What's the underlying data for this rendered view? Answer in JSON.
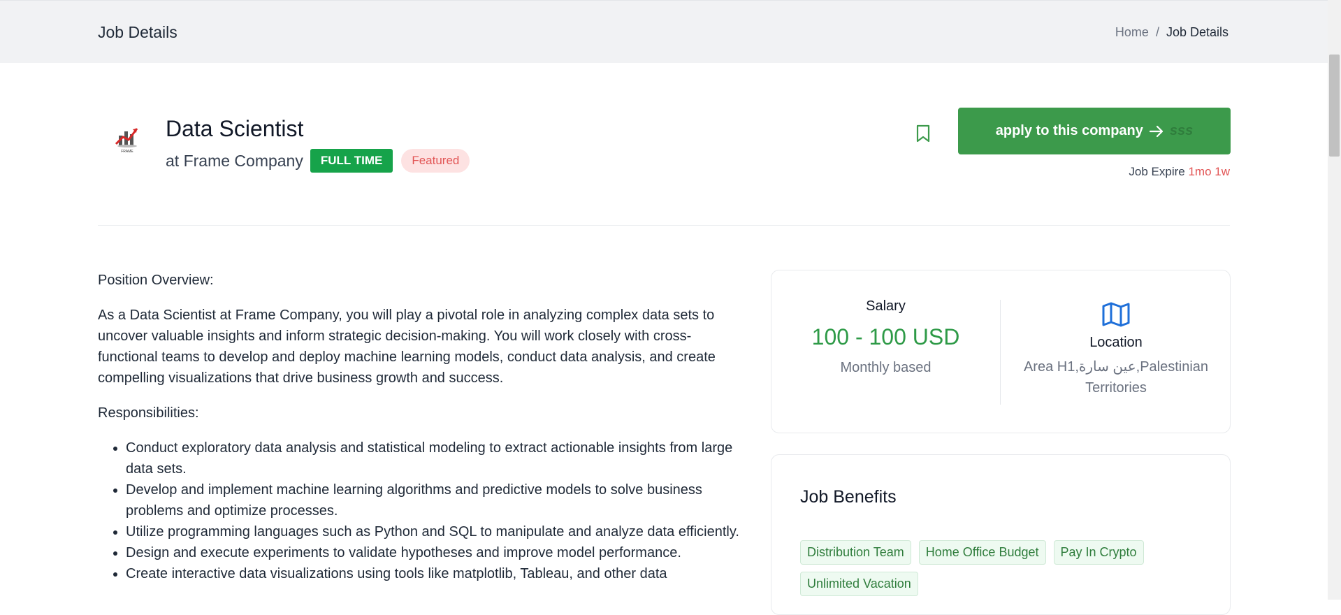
{
  "header": {
    "title": "Job Details",
    "breadcrumb": {
      "home": "Home",
      "separator": "/",
      "current": "Job Details"
    }
  },
  "job": {
    "title": "Data Scientist",
    "company": "at Frame Company",
    "type_badge": "FULL TIME",
    "featured_badge": "Featured",
    "logo_text": "FRAME"
  },
  "actions": {
    "apply_label": "apply to this company",
    "apply_tail": "sss",
    "expire_label": "Job Expire",
    "expire_value": "1mo 1w"
  },
  "description": {
    "overview_heading": "Position Overview:",
    "overview_text": "As a Data Scientist at Frame Company, you will play a pivotal role in analyzing complex data sets to uncover valuable insights and inform strategic decision-making. You will work closely with cross-functional teams to develop and deploy machine learning models, conduct data analysis, and create compelling visualizations that drive business growth and success.",
    "responsibilities_heading": "Responsibilities:",
    "responsibilities": [
      "Conduct exploratory data analysis and statistical modeling to extract actionable insights from large data sets.",
      "Develop and implement machine learning algorithms and predictive models to solve business problems and optimize processes.",
      "Utilize programming languages such as Python and SQL to manipulate and analyze data efficiently.",
      "Design and execute experiments to validate hypotheses and improve model performance.",
      "Create interactive data visualizations using tools like matplotlib, Tableau, and other data"
    ]
  },
  "salary": {
    "label": "Salary",
    "value": "100 - 100 USD",
    "basis": "Monthly based"
  },
  "location": {
    "label": "Location",
    "value": "Area H1,عين سارة,Palestinian Territories"
  },
  "benefits": {
    "title": "Job Benefits",
    "tags": [
      "Distribution Team",
      "Home Office Budget",
      "Pay In Crypto",
      "Unlimited Vacation"
    ]
  },
  "colors": {
    "accent_green": "#3c9a4b",
    "badge_green": "#16a34a",
    "featured_red": "#e25555",
    "salary_green": "#2e9a47",
    "icon_blue": "#1e6fd9"
  },
  "icons": {
    "bookmark": "bookmark-icon",
    "arrow": "arrow-right-icon",
    "map": "map-icon"
  }
}
